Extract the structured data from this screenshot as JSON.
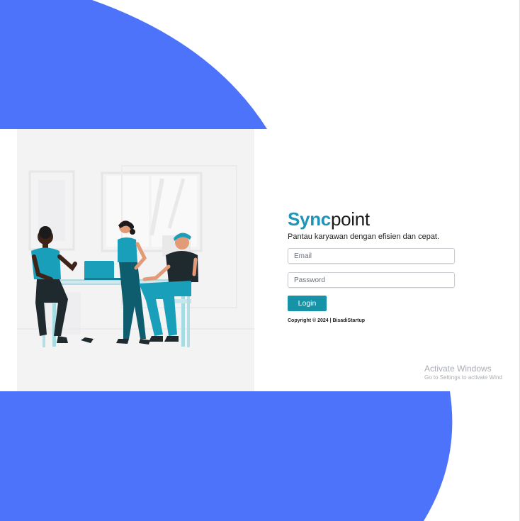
{
  "brand": {
    "part1": "Sync",
    "part2": "point"
  },
  "tagline": "Pantau karyawan dengan efisien dan cepat.",
  "form": {
    "email_placeholder": "Email",
    "password_placeholder": "Password",
    "login_label": "Login"
  },
  "footer": {
    "copyright": "Copyright © 2024 | BisadiStartup"
  },
  "watermark": {
    "title": "Activate Windows",
    "subtitle": "Go to Settings to activate Windows."
  },
  "colors": {
    "background_blob": "#4d73fb",
    "brand_primary": "#1e95b8",
    "button": "#1693a7",
    "illustration_bg": "#f3f3f4"
  },
  "icons": {
    "illustration": "team-meeting-illustration"
  }
}
